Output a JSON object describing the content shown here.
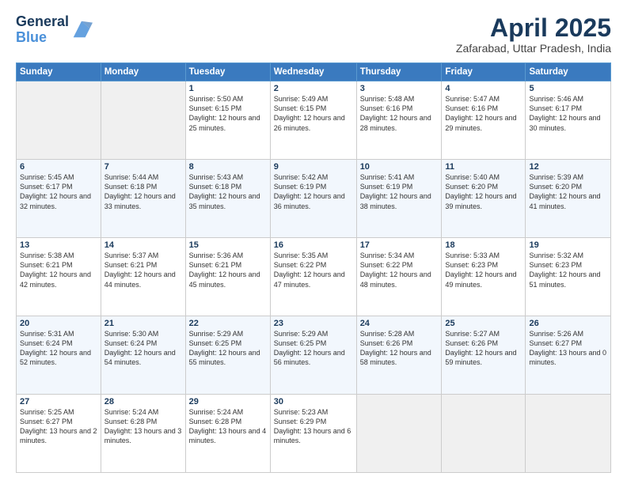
{
  "header": {
    "logo_line1": "General",
    "logo_line2": "Blue",
    "month_title": "April 2025",
    "subtitle": "Zafarabad, Uttar Pradesh, India"
  },
  "days_of_week": [
    "Sunday",
    "Monday",
    "Tuesday",
    "Wednesday",
    "Thursday",
    "Friday",
    "Saturday"
  ],
  "weeks": [
    [
      {
        "day": "",
        "info": ""
      },
      {
        "day": "",
        "info": ""
      },
      {
        "day": "1",
        "info": "Sunrise: 5:50 AM\nSunset: 6:15 PM\nDaylight: 12 hours and 25 minutes."
      },
      {
        "day": "2",
        "info": "Sunrise: 5:49 AM\nSunset: 6:15 PM\nDaylight: 12 hours and 26 minutes."
      },
      {
        "day": "3",
        "info": "Sunrise: 5:48 AM\nSunset: 6:16 PM\nDaylight: 12 hours and 28 minutes."
      },
      {
        "day": "4",
        "info": "Sunrise: 5:47 AM\nSunset: 6:16 PM\nDaylight: 12 hours and 29 minutes."
      },
      {
        "day": "5",
        "info": "Sunrise: 5:46 AM\nSunset: 6:17 PM\nDaylight: 12 hours and 30 minutes."
      }
    ],
    [
      {
        "day": "6",
        "info": "Sunrise: 5:45 AM\nSunset: 6:17 PM\nDaylight: 12 hours and 32 minutes."
      },
      {
        "day": "7",
        "info": "Sunrise: 5:44 AM\nSunset: 6:18 PM\nDaylight: 12 hours and 33 minutes."
      },
      {
        "day": "8",
        "info": "Sunrise: 5:43 AM\nSunset: 6:18 PM\nDaylight: 12 hours and 35 minutes."
      },
      {
        "day": "9",
        "info": "Sunrise: 5:42 AM\nSunset: 6:19 PM\nDaylight: 12 hours and 36 minutes."
      },
      {
        "day": "10",
        "info": "Sunrise: 5:41 AM\nSunset: 6:19 PM\nDaylight: 12 hours and 38 minutes."
      },
      {
        "day": "11",
        "info": "Sunrise: 5:40 AM\nSunset: 6:20 PM\nDaylight: 12 hours and 39 minutes."
      },
      {
        "day": "12",
        "info": "Sunrise: 5:39 AM\nSunset: 6:20 PM\nDaylight: 12 hours and 41 minutes."
      }
    ],
    [
      {
        "day": "13",
        "info": "Sunrise: 5:38 AM\nSunset: 6:21 PM\nDaylight: 12 hours and 42 minutes."
      },
      {
        "day": "14",
        "info": "Sunrise: 5:37 AM\nSunset: 6:21 PM\nDaylight: 12 hours and 44 minutes."
      },
      {
        "day": "15",
        "info": "Sunrise: 5:36 AM\nSunset: 6:21 PM\nDaylight: 12 hours and 45 minutes."
      },
      {
        "day": "16",
        "info": "Sunrise: 5:35 AM\nSunset: 6:22 PM\nDaylight: 12 hours and 47 minutes."
      },
      {
        "day": "17",
        "info": "Sunrise: 5:34 AM\nSunset: 6:22 PM\nDaylight: 12 hours and 48 minutes."
      },
      {
        "day": "18",
        "info": "Sunrise: 5:33 AM\nSunset: 6:23 PM\nDaylight: 12 hours and 49 minutes."
      },
      {
        "day": "19",
        "info": "Sunrise: 5:32 AM\nSunset: 6:23 PM\nDaylight: 12 hours and 51 minutes."
      }
    ],
    [
      {
        "day": "20",
        "info": "Sunrise: 5:31 AM\nSunset: 6:24 PM\nDaylight: 12 hours and 52 minutes."
      },
      {
        "day": "21",
        "info": "Sunrise: 5:30 AM\nSunset: 6:24 PM\nDaylight: 12 hours and 54 minutes."
      },
      {
        "day": "22",
        "info": "Sunrise: 5:29 AM\nSunset: 6:25 PM\nDaylight: 12 hours and 55 minutes."
      },
      {
        "day": "23",
        "info": "Sunrise: 5:29 AM\nSunset: 6:25 PM\nDaylight: 12 hours and 56 minutes."
      },
      {
        "day": "24",
        "info": "Sunrise: 5:28 AM\nSunset: 6:26 PM\nDaylight: 12 hours and 58 minutes."
      },
      {
        "day": "25",
        "info": "Sunrise: 5:27 AM\nSunset: 6:26 PM\nDaylight: 12 hours and 59 minutes."
      },
      {
        "day": "26",
        "info": "Sunrise: 5:26 AM\nSunset: 6:27 PM\nDaylight: 13 hours and 0 minutes."
      }
    ],
    [
      {
        "day": "27",
        "info": "Sunrise: 5:25 AM\nSunset: 6:27 PM\nDaylight: 13 hours and 2 minutes."
      },
      {
        "day": "28",
        "info": "Sunrise: 5:24 AM\nSunset: 6:28 PM\nDaylight: 13 hours and 3 minutes."
      },
      {
        "day": "29",
        "info": "Sunrise: 5:24 AM\nSunset: 6:28 PM\nDaylight: 13 hours and 4 minutes."
      },
      {
        "day": "30",
        "info": "Sunrise: 5:23 AM\nSunset: 6:29 PM\nDaylight: 13 hours and 6 minutes."
      },
      {
        "day": "",
        "info": ""
      },
      {
        "day": "",
        "info": ""
      },
      {
        "day": "",
        "info": ""
      }
    ]
  ]
}
